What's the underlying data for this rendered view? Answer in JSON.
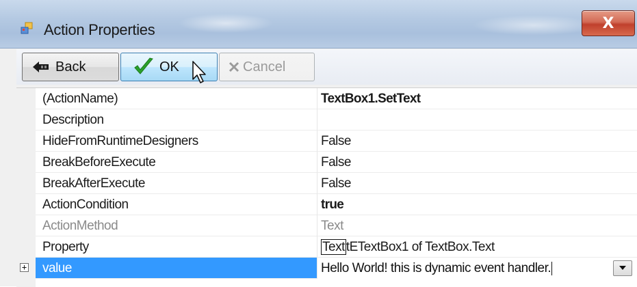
{
  "window": {
    "title": "Action Properties",
    "close_glyph": "X",
    "icon": "properties-window-icon"
  },
  "toolbar": {
    "back_label": "Back",
    "ok_label": "OK",
    "cancel_label": "Cancel",
    "back_icon": "arrow-left-icon",
    "ok_icon": "check-icon",
    "cancel_icon": "x-icon"
  },
  "grid": {
    "rows": [
      {
        "name": "(ActionName)",
        "value": "TextBox1.SetText",
        "bold": true
      },
      {
        "name": "Description",
        "value": ""
      },
      {
        "name": "HideFromRuntimeDesigners",
        "value": "False"
      },
      {
        "name": "BreakBeforeExecute",
        "value": "False"
      },
      {
        "name": "BreakAfterExecute",
        "value": "False"
      },
      {
        "name": "ActionCondition",
        "value": "true",
        "bold": true
      },
      {
        "name": "ActionMethod",
        "value": "Text",
        "disabled": true
      },
      {
        "name": "Property",
        "value_boxed": "Text",
        "value_rest": "tETextBox1 of TextBox.Text"
      },
      {
        "name": "value",
        "value": "Hello World! this is dynamic event handler.",
        "selected": true,
        "expandable": true
      }
    ]
  },
  "colors": {
    "selection": "#3399ff",
    "title_bar": "#b4c9e2",
    "close_button": "#c0402c",
    "ok_check": "#2aa12a",
    "disabled_text": "#8a8a8a"
  }
}
